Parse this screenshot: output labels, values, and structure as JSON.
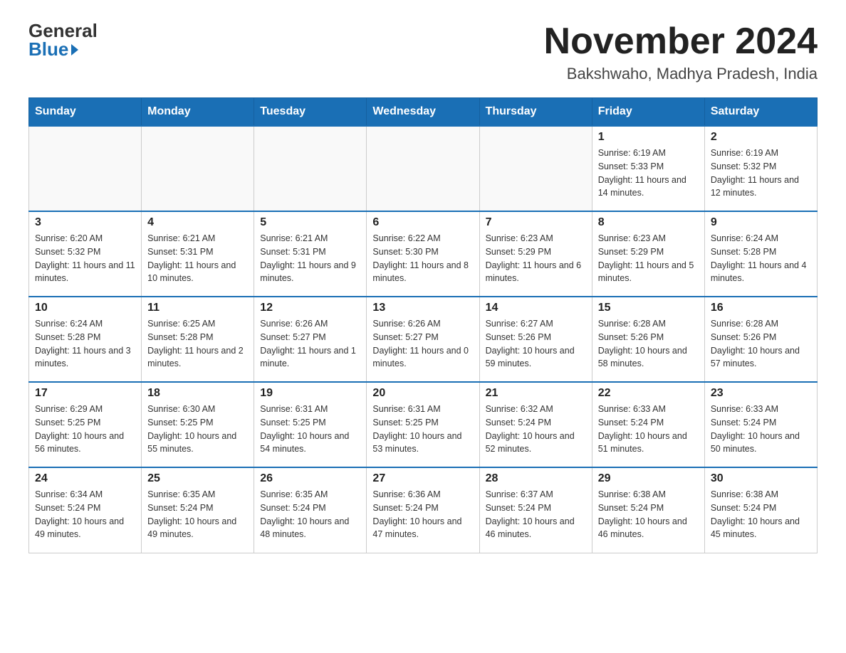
{
  "header": {
    "logo_general": "General",
    "logo_blue": "Blue",
    "main_title": "November 2024",
    "subtitle": "Bakshwaho, Madhya Pradesh, India"
  },
  "calendar": {
    "days_of_week": [
      "Sunday",
      "Monday",
      "Tuesday",
      "Wednesday",
      "Thursday",
      "Friday",
      "Saturday"
    ],
    "weeks": [
      [
        {
          "day": "",
          "sunrise": "",
          "sunset": "",
          "daylight": "",
          "empty": true
        },
        {
          "day": "",
          "sunrise": "",
          "sunset": "",
          "daylight": "",
          "empty": true
        },
        {
          "day": "",
          "sunrise": "",
          "sunset": "",
          "daylight": "",
          "empty": true
        },
        {
          "day": "",
          "sunrise": "",
          "sunset": "",
          "daylight": "",
          "empty": true
        },
        {
          "day": "",
          "sunrise": "",
          "sunset": "",
          "daylight": "",
          "empty": true
        },
        {
          "day": "1",
          "sunrise": "Sunrise: 6:19 AM",
          "sunset": "Sunset: 5:33 PM",
          "daylight": "Daylight: 11 hours and 14 minutes.",
          "empty": false
        },
        {
          "day": "2",
          "sunrise": "Sunrise: 6:19 AM",
          "sunset": "Sunset: 5:32 PM",
          "daylight": "Daylight: 11 hours and 12 minutes.",
          "empty": false
        }
      ],
      [
        {
          "day": "3",
          "sunrise": "Sunrise: 6:20 AM",
          "sunset": "Sunset: 5:32 PM",
          "daylight": "Daylight: 11 hours and 11 minutes.",
          "empty": false
        },
        {
          "day": "4",
          "sunrise": "Sunrise: 6:21 AM",
          "sunset": "Sunset: 5:31 PM",
          "daylight": "Daylight: 11 hours and 10 minutes.",
          "empty": false
        },
        {
          "day": "5",
          "sunrise": "Sunrise: 6:21 AM",
          "sunset": "Sunset: 5:31 PM",
          "daylight": "Daylight: 11 hours and 9 minutes.",
          "empty": false
        },
        {
          "day": "6",
          "sunrise": "Sunrise: 6:22 AM",
          "sunset": "Sunset: 5:30 PM",
          "daylight": "Daylight: 11 hours and 8 minutes.",
          "empty": false
        },
        {
          "day": "7",
          "sunrise": "Sunrise: 6:23 AM",
          "sunset": "Sunset: 5:29 PM",
          "daylight": "Daylight: 11 hours and 6 minutes.",
          "empty": false
        },
        {
          "day": "8",
          "sunrise": "Sunrise: 6:23 AM",
          "sunset": "Sunset: 5:29 PM",
          "daylight": "Daylight: 11 hours and 5 minutes.",
          "empty": false
        },
        {
          "day": "9",
          "sunrise": "Sunrise: 6:24 AM",
          "sunset": "Sunset: 5:28 PM",
          "daylight": "Daylight: 11 hours and 4 minutes.",
          "empty": false
        }
      ],
      [
        {
          "day": "10",
          "sunrise": "Sunrise: 6:24 AM",
          "sunset": "Sunset: 5:28 PM",
          "daylight": "Daylight: 11 hours and 3 minutes.",
          "empty": false
        },
        {
          "day": "11",
          "sunrise": "Sunrise: 6:25 AM",
          "sunset": "Sunset: 5:28 PM",
          "daylight": "Daylight: 11 hours and 2 minutes.",
          "empty": false
        },
        {
          "day": "12",
          "sunrise": "Sunrise: 6:26 AM",
          "sunset": "Sunset: 5:27 PM",
          "daylight": "Daylight: 11 hours and 1 minute.",
          "empty": false
        },
        {
          "day": "13",
          "sunrise": "Sunrise: 6:26 AM",
          "sunset": "Sunset: 5:27 PM",
          "daylight": "Daylight: 11 hours and 0 minutes.",
          "empty": false
        },
        {
          "day": "14",
          "sunrise": "Sunrise: 6:27 AM",
          "sunset": "Sunset: 5:26 PM",
          "daylight": "Daylight: 10 hours and 59 minutes.",
          "empty": false
        },
        {
          "day": "15",
          "sunrise": "Sunrise: 6:28 AM",
          "sunset": "Sunset: 5:26 PM",
          "daylight": "Daylight: 10 hours and 58 minutes.",
          "empty": false
        },
        {
          "day": "16",
          "sunrise": "Sunrise: 6:28 AM",
          "sunset": "Sunset: 5:26 PM",
          "daylight": "Daylight: 10 hours and 57 minutes.",
          "empty": false
        }
      ],
      [
        {
          "day": "17",
          "sunrise": "Sunrise: 6:29 AM",
          "sunset": "Sunset: 5:25 PM",
          "daylight": "Daylight: 10 hours and 56 minutes.",
          "empty": false
        },
        {
          "day": "18",
          "sunrise": "Sunrise: 6:30 AM",
          "sunset": "Sunset: 5:25 PM",
          "daylight": "Daylight: 10 hours and 55 minutes.",
          "empty": false
        },
        {
          "day": "19",
          "sunrise": "Sunrise: 6:31 AM",
          "sunset": "Sunset: 5:25 PM",
          "daylight": "Daylight: 10 hours and 54 minutes.",
          "empty": false
        },
        {
          "day": "20",
          "sunrise": "Sunrise: 6:31 AM",
          "sunset": "Sunset: 5:25 PM",
          "daylight": "Daylight: 10 hours and 53 minutes.",
          "empty": false
        },
        {
          "day": "21",
          "sunrise": "Sunrise: 6:32 AM",
          "sunset": "Sunset: 5:24 PM",
          "daylight": "Daylight: 10 hours and 52 minutes.",
          "empty": false
        },
        {
          "day": "22",
          "sunrise": "Sunrise: 6:33 AM",
          "sunset": "Sunset: 5:24 PM",
          "daylight": "Daylight: 10 hours and 51 minutes.",
          "empty": false
        },
        {
          "day": "23",
          "sunrise": "Sunrise: 6:33 AM",
          "sunset": "Sunset: 5:24 PM",
          "daylight": "Daylight: 10 hours and 50 minutes.",
          "empty": false
        }
      ],
      [
        {
          "day": "24",
          "sunrise": "Sunrise: 6:34 AM",
          "sunset": "Sunset: 5:24 PM",
          "daylight": "Daylight: 10 hours and 49 minutes.",
          "empty": false
        },
        {
          "day": "25",
          "sunrise": "Sunrise: 6:35 AM",
          "sunset": "Sunset: 5:24 PM",
          "daylight": "Daylight: 10 hours and 49 minutes.",
          "empty": false
        },
        {
          "day": "26",
          "sunrise": "Sunrise: 6:35 AM",
          "sunset": "Sunset: 5:24 PM",
          "daylight": "Daylight: 10 hours and 48 minutes.",
          "empty": false
        },
        {
          "day": "27",
          "sunrise": "Sunrise: 6:36 AM",
          "sunset": "Sunset: 5:24 PM",
          "daylight": "Daylight: 10 hours and 47 minutes.",
          "empty": false
        },
        {
          "day": "28",
          "sunrise": "Sunrise: 6:37 AM",
          "sunset": "Sunset: 5:24 PM",
          "daylight": "Daylight: 10 hours and 46 minutes.",
          "empty": false
        },
        {
          "day": "29",
          "sunrise": "Sunrise: 6:38 AM",
          "sunset": "Sunset: 5:24 PM",
          "daylight": "Daylight: 10 hours and 46 minutes.",
          "empty": false
        },
        {
          "day": "30",
          "sunrise": "Sunrise: 6:38 AM",
          "sunset": "Sunset: 5:24 PM",
          "daylight": "Daylight: 10 hours and 45 minutes.",
          "empty": false
        }
      ]
    ]
  }
}
